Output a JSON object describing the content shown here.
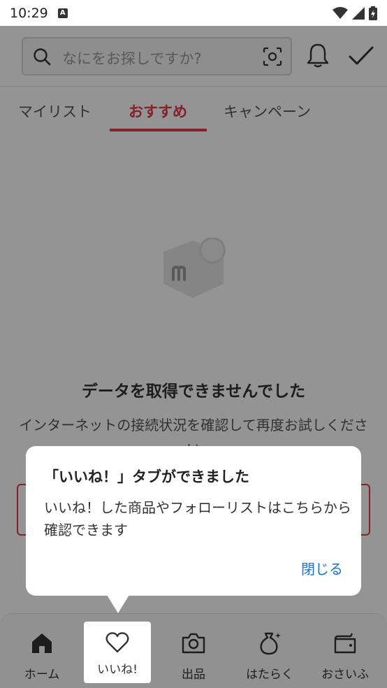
{
  "status_bar": {
    "time": "10:29",
    "notification_glyph": "A"
  },
  "header": {
    "search_placeholder": "なにをお探しですか?",
    "icons": [
      "search-icon",
      "scan-icon",
      "bell-icon",
      "check-icon"
    ]
  },
  "tabs": [
    {
      "label": "マイリスト",
      "active": false
    },
    {
      "label": "おすすめ",
      "active": true
    },
    {
      "label": "キャンペーン",
      "active": false
    }
  ],
  "error": {
    "title": "データを取得できませんでした",
    "description": "インターネットの接続状況を確認して再度お試しください"
  },
  "tooltip": {
    "title": "「いいね！」タブができました",
    "body": "いいね！した商品やフォローリストはこちらから確認できます",
    "close_label": "閉じる"
  },
  "bottom_nav": [
    {
      "label": "ホーム",
      "icon": "home-icon"
    },
    {
      "label": "いいね!",
      "icon": "heart-icon"
    },
    {
      "label": "出品",
      "icon": "camera-icon"
    },
    {
      "label": "はたらく",
      "icon": "money-bag-icon"
    },
    {
      "label": "おさいふ",
      "icon": "wallet-icon"
    }
  ],
  "colors": {
    "accent": "#e53945",
    "link": "#1a73c9",
    "overlay": "rgba(0,0,0,0.42)"
  }
}
